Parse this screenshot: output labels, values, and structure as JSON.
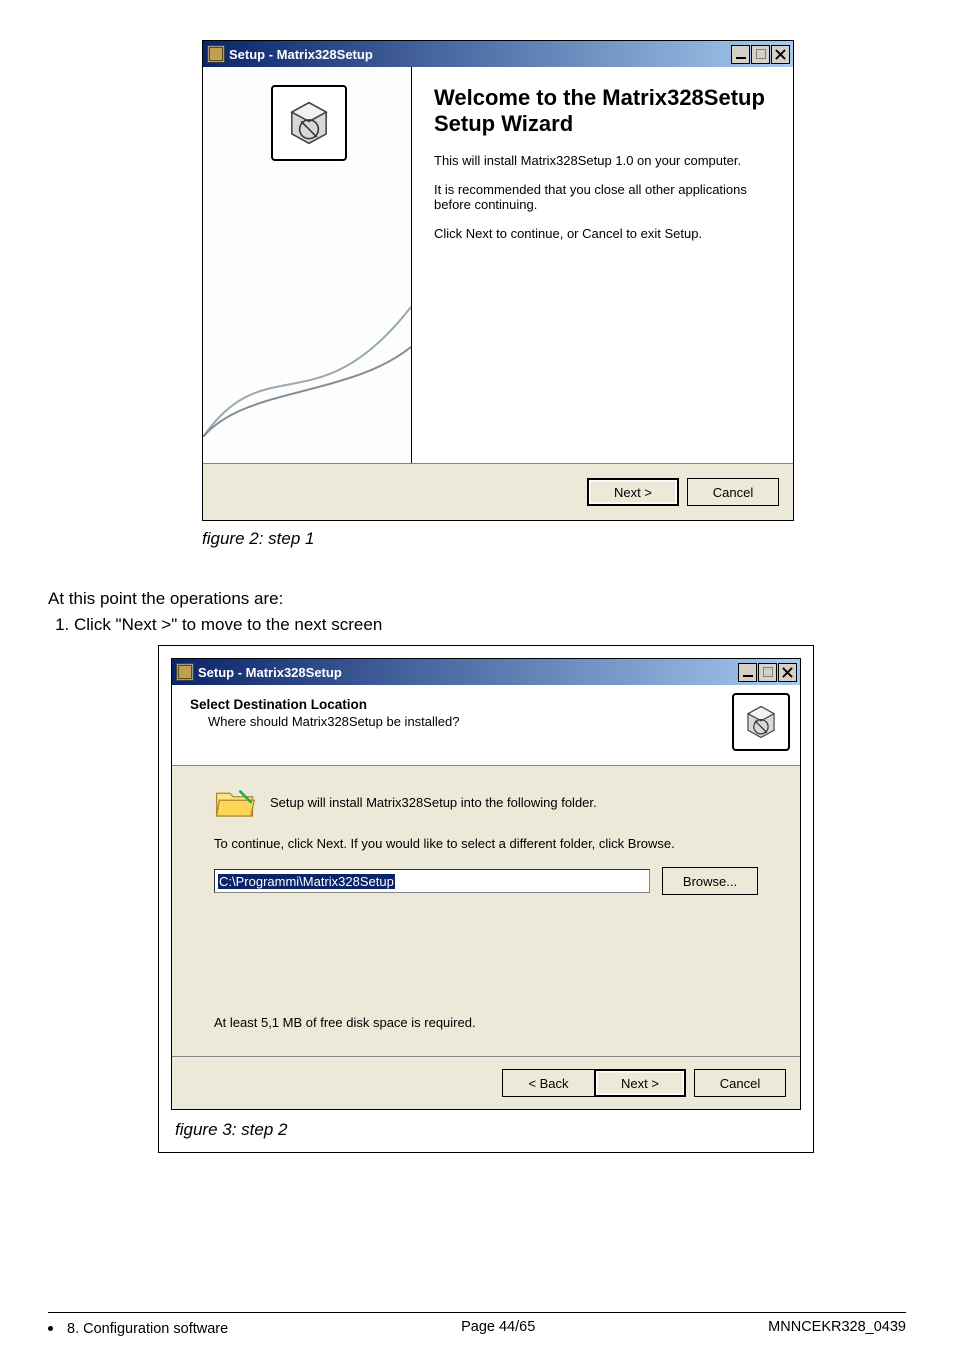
{
  "dialog1": {
    "titlebar": "Setup - Matrix328Setup",
    "heading": "Welcome to the Matrix328Setup Setup Wizard",
    "p1": "This will install Matrix328Setup 1.0 on your computer.",
    "p2": "It is recommended that you close all other applications before continuing.",
    "p3": "Click Next to continue, or Cancel to exit Setup.",
    "next": "Next >",
    "cancel": "Cancel"
  },
  "figure2_caption": "figure 2: step 1",
  "body_text": "At this point the operations are:",
  "step_items": [
    "Click \"Next >\" to move to the next screen"
  ],
  "dialog2": {
    "titlebar": "Setup - Matrix328Setup",
    "header_title": "Select Destination Location",
    "header_sub": "Where should Matrix328Setup be installed?",
    "line1": "Setup will install Matrix328Setup into the following folder.",
    "line2": "To continue, click Next. If you would like to select a different folder, click Browse.",
    "path": "C:\\Programmi\\Matrix328Setup",
    "browse": "Browse...",
    "req": "At least 5,1 MB of free disk space is required.",
    "back": "< Back",
    "next": "Next >",
    "cancel": "Cancel"
  },
  "figure3_caption": "figure 3: step 2",
  "footer": {
    "section": "8. Configuration software",
    "page": "Page 44/65",
    "doc": "MNNCEKR328_0439"
  }
}
